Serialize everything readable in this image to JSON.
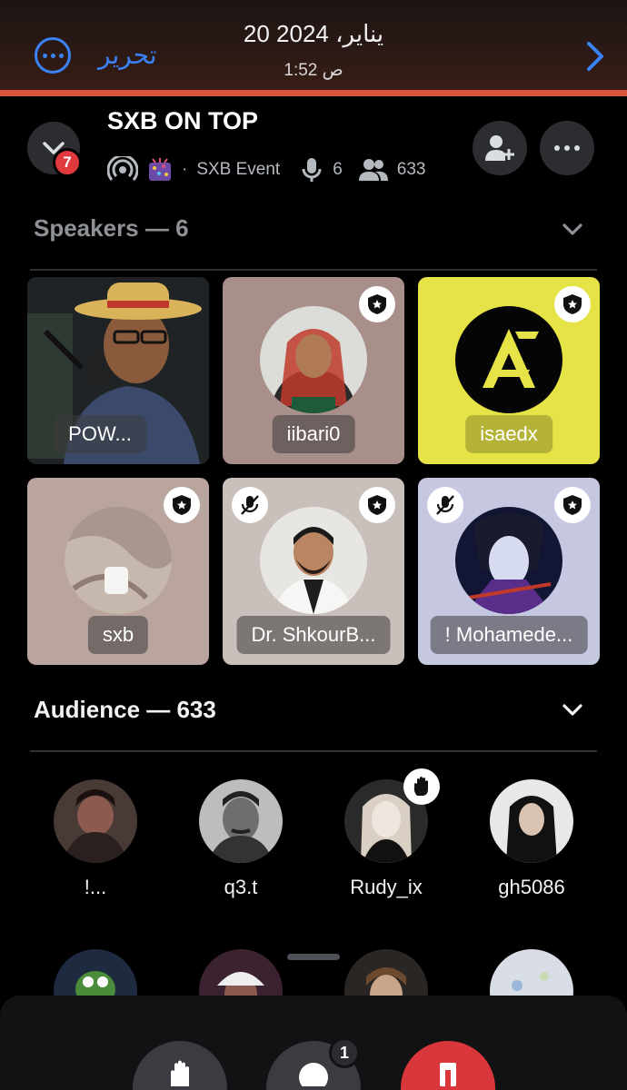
{
  "photo_header": {
    "edit_label": "تحرير",
    "date": "20 يناير، 2024",
    "time": "1:52 ص"
  },
  "stage": {
    "notification_count": "7",
    "title": "SXB ON TOP",
    "event_label": "SXB Event",
    "speaker_count": "6",
    "listener_count": "633"
  },
  "speakers_section": {
    "header": "Speakers — 6"
  },
  "speakers": [
    {
      "name": "POW...",
      "bg": "#2a2a2a",
      "moderator": false,
      "muted": false
    },
    {
      "name": "iibari0",
      "bg": "#a88f8a",
      "moderator": true,
      "muted": false
    },
    {
      "name": "isaedx",
      "bg": "#e6e346",
      "moderator": true,
      "muted": false
    },
    {
      "name": "sxb",
      "bg": "#b9a59e",
      "moderator": true,
      "muted": false
    },
    {
      "name": "Dr. ShkourB...",
      "bg": "#c9bfbb",
      "moderator": true,
      "muted": true
    },
    {
      "name": "! Mohamede...",
      "bg": "#c5c8e0",
      "moderator": true,
      "muted": true
    }
  ],
  "audience_section": {
    "header": "Audience — 633"
  },
  "audience": [
    {
      "name": "!..."
    },
    {
      "name": "q3.t"
    },
    {
      "name": "Rudy_ix"
    },
    {
      "name": "gh5086"
    }
  ],
  "controls": {
    "speak_count": "1"
  },
  "icons": {
    "more": "ellipsis-circle-icon",
    "next": "chevron-right-icon",
    "collapse": "chevron-down-icon",
    "invite": "add-user-icon",
    "moderator": "shield-star-icon",
    "muted": "mic-off-icon",
    "hand": "raised-hand-icon",
    "leave": "leave-icon"
  },
  "colors": {
    "ios_blue": "#3b82f6",
    "leave_red": "#da373c",
    "badge_red": "#e03a3e"
  }
}
